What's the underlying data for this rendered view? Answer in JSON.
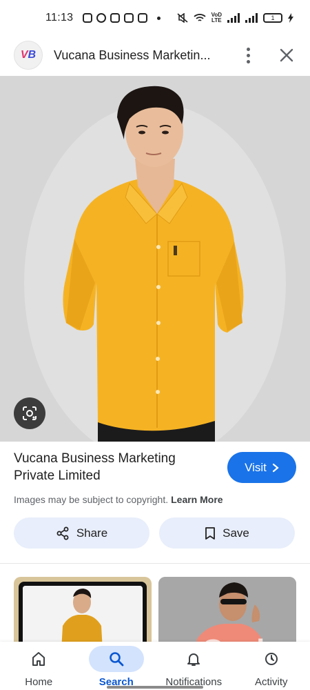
{
  "status_bar": {
    "time": "11:13",
    "battery": "1",
    "network_label": "VoD LTE"
  },
  "header": {
    "logo_text": "VB",
    "title": "Vucana Business Marketin..."
  },
  "image": {
    "subject": "Man wearing a yellow shirt",
    "shirt_color": "#f5b324"
  },
  "source": {
    "title": "Vucana Business Marketing Private Limited",
    "visit_label": "Visit",
    "copyright_text": "Images may be subject to copyright.",
    "learn_more_label": "Learn More"
  },
  "actions": {
    "share_label": "Share",
    "save_label": "Save"
  },
  "bottom_nav": {
    "items": [
      {
        "label": "Home",
        "icon": "home-icon",
        "active": false
      },
      {
        "label": "Search",
        "icon": "search-icon",
        "active": true
      },
      {
        "label": "Notifications",
        "icon": "bell-icon",
        "active": false
      },
      {
        "label": "Activity",
        "icon": "activity-icon",
        "active": false
      }
    ]
  },
  "watermark": "Gsale",
  "colors": {
    "accent": "#1a73e8",
    "pill_bg": "#e8eefb",
    "active_nav_bg": "#d3e3fd"
  }
}
